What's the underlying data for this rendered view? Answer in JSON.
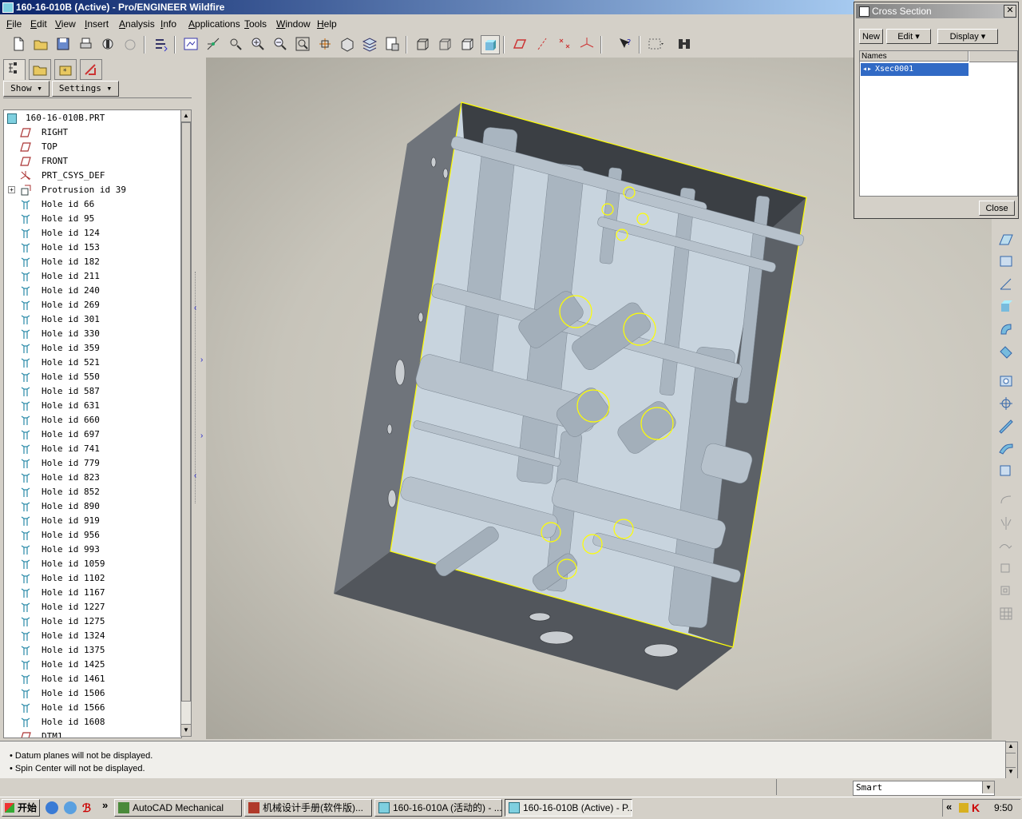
{
  "window": {
    "title": "160-16-010B (Active) - Pro/ENGINEER Wildfire"
  },
  "menu": [
    "File",
    "Edit",
    "View",
    "Insert",
    "Analysis",
    "Info",
    "Applications",
    "Tools",
    "Window",
    "Help"
  ],
  "nav": {
    "show_label": "Show",
    "settings_label": "Settings"
  },
  "tree": {
    "root": "160-16-010B.PRT",
    "items": [
      {
        "label": "RIGHT",
        "icon": "datum-plane-icon"
      },
      {
        "label": "TOP",
        "icon": "datum-plane-icon"
      },
      {
        "label": "FRONT",
        "icon": "datum-plane-icon"
      },
      {
        "label": "PRT_CSYS_DEF",
        "icon": "csys-icon"
      },
      {
        "label": "Protrusion id 39",
        "icon": "protrusion-icon"
      },
      {
        "label": "Hole id 66",
        "icon": "hole-icon"
      },
      {
        "label": "Hole id 95",
        "icon": "hole-icon"
      },
      {
        "label": "Hole id 124",
        "icon": "hole-icon"
      },
      {
        "label": "Hole id 153",
        "icon": "hole-icon"
      },
      {
        "label": "Hole id 182",
        "icon": "hole-icon"
      },
      {
        "label": "Hole id 211",
        "icon": "hole-icon"
      },
      {
        "label": "Hole id 240",
        "icon": "hole-icon"
      },
      {
        "label": "Hole id 269",
        "icon": "hole-icon"
      },
      {
        "label": "Hole id 301",
        "icon": "hole-icon"
      },
      {
        "label": "Hole id 330",
        "icon": "hole-icon"
      },
      {
        "label": "Hole id 359",
        "icon": "hole-icon"
      },
      {
        "label": "Hole id 521",
        "icon": "hole-icon"
      },
      {
        "label": "Hole id 550",
        "icon": "hole-icon"
      },
      {
        "label": "Hole id 587",
        "icon": "hole-icon"
      },
      {
        "label": "Hole id 631",
        "icon": "hole-icon"
      },
      {
        "label": "Hole id 660",
        "icon": "hole-icon"
      },
      {
        "label": "Hole id 697",
        "icon": "hole-icon"
      },
      {
        "label": "Hole id 741",
        "icon": "hole-icon"
      },
      {
        "label": "Hole id 779",
        "icon": "hole-icon"
      },
      {
        "label": "Hole id 823",
        "icon": "hole-icon"
      },
      {
        "label": "Hole id 852",
        "icon": "hole-icon"
      },
      {
        "label": "Hole id 890",
        "icon": "hole-icon"
      },
      {
        "label": "Hole id 919",
        "icon": "hole-icon"
      },
      {
        "label": "Hole id 956",
        "icon": "hole-icon"
      },
      {
        "label": "Hole id 993",
        "icon": "hole-icon"
      },
      {
        "label": "Hole id 1059",
        "icon": "hole-icon"
      },
      {
        "label": "Hole id 1102",
        "icon": "hole-icon"
      },
      {
        "label": "Hole id 1167",
        "icon": "hole-icon"
      },
      {
        "label": "Hole id 1227",
        "icon": "hole-icon"
      },
      {
        "label": "Hole id 1275",
        "icon": "hole-icon"
      },
      {
        "label": "Hole id 1324",
        "icon": "hole-icon"
      },
      {
        "label": "Hole id 1375",
        "icon": "hole-icon"
      },
      {
        "label": "Hole id 1425",
        "icon": "hole-icon"
      },
      {
        "label": "Hole id 1461",
        "icon": "hole-icon"
      },
      {
        "label": "Hole id 1506",
        "icon": "hole-icon"
      },
      {
        "label": "Hole id 1566",
        "icon": "hole-icon"
      },
      {
        "label": "Hole id 1608",
        "icon": "hole-icon"
      },
      {
        "label": "DTM1",
        "icon": "datum-plane-icon"
      }
    ]
  },
  "xsec": {
    "title": "Cross Section",
    "new_label": "New",
    "edit_label": "Edit",
    "display_label": "Display",
    "names_header": "Names",
    "selected_name": "Xsec0001",
    "close_label": "Close"
  },
  "messages": [
    "Datum planes will not be displayed.",
    "Spin Center will not be displayed."
  ],
  "status": {
    "filter": "Smart"
  },
  "taskbar": {
    "start": "开始",
    "tasks": [
      "AutoCAD Mechanical",
      "机械设计手册(软件版)...",
      "160-16-010A (活动的) - ...",
      "160-16-010B (Active) - P..."
    ],
    "clock": "9:50",
    "chevron": "»",
    "tray_chevron": "«"
  },
  "colors": {
    "title_active": "#0a246a",
    "highlight": "#316ac5",
    "edge_highlight": "#ffff00"
  }
}
